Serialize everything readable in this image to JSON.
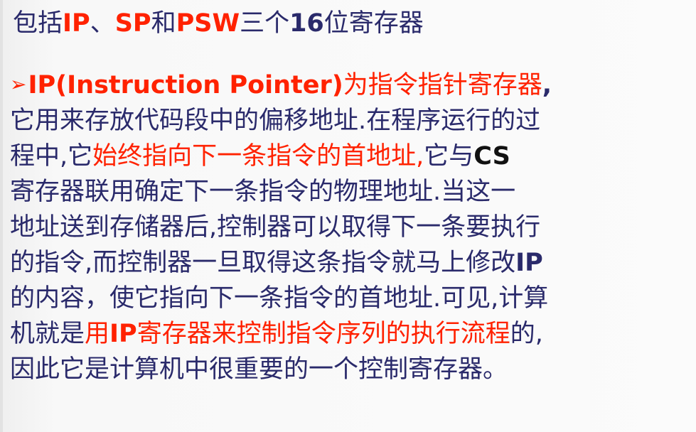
{
  "headline": {
    "part1": "包括",
    "ip": "IP",
    "sep": "、",
    "sp": "SP",
    "and": "和",
    "psw": "PSW",
    "part2": "三个",
    "num": "16",
    "part3": "位寄存器"
  },
  "body": {
    "bullet": "➢",
    "l1_term": "IP(Instruction Pointer)",
    "l1_def": "为指令指针寄存器",
    "l1_comma": ",",
    "l2": "它用来存放代码段中的偏移地址.在程序运行的过",
    "l3_a": "程中,它",
    "l3_b": "始终指向下一条指令的首地址,",
    "l3_c": "它与",
    "l3_cs": "CS",
    "l4": "寄存器联用确定下一条指令的物理地址.当这一",
    "l5": "地址送到存储器后,控制器可以取得下一条要执行",
    "l6_a": "的指令,而控制器一旦取得这条指令就马上修改",
    "l6_ip": "IP",
    "l7": "的内容，使它指向下一条指令的首地址.可见,计算",
    "l8_a": "机就是",
    "l8_b1": "用",
    "l8_ip": "IP",
    "l8_b2": "寄存器来控制指令序列的执行流程",
    "l8_c": "的,",
    "l9": "因此它是计算机中很重要的一个控制寄存器。"
  }
}
